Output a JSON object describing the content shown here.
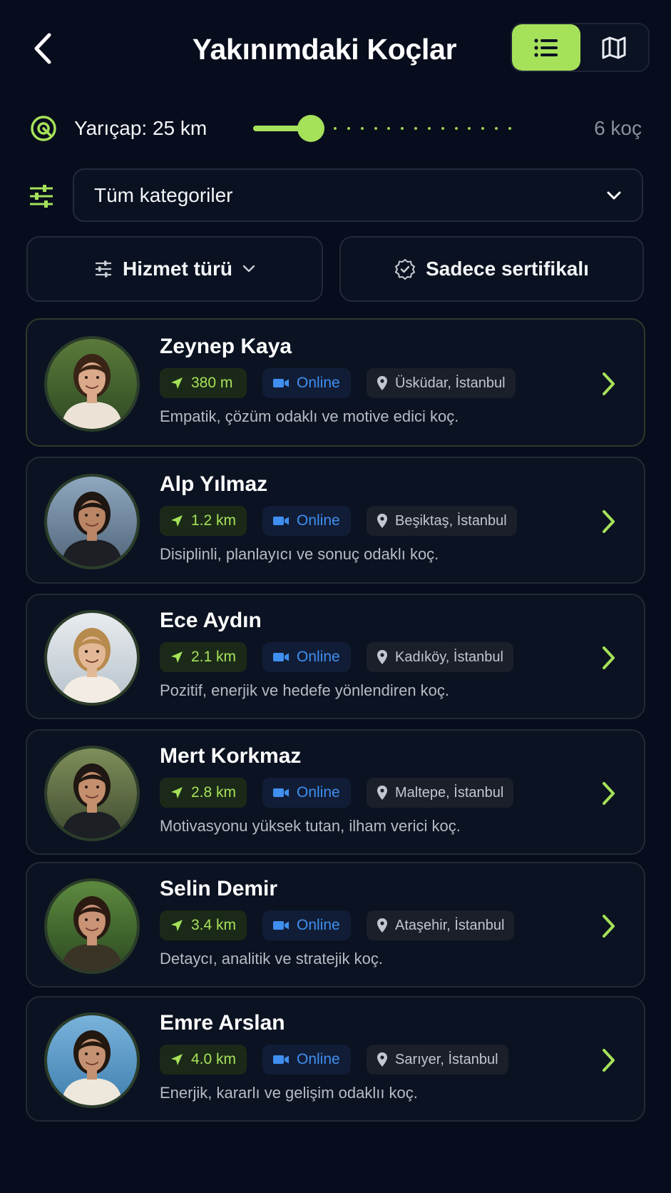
{
  "header": {
    "title": "Yakınımdaki Koçlar"
  },
  "filters": {
    "radius_label": "Yarıçap: 25 km",
    "radius_fraction": 0.22,
    "coach_count": "6 koç",
    "category": "Tüm kategoriler",
    "service_type": "Hizmet türü",
    "certified_only": "Sadece sertifikalı"
  },
  "colors": {
    "accent": "#a6e15a",
    "online": "#3f8ff0",
    "background": "#070d1c"
  },
  "coaches": [
    {
      "name": "Zeynep Kaya",
      "distance": "380 m",
      "mode": "Online",
      "location": "Üsküdar, İstanbul",
      "description": "Empatik, çözüm odaklı ve motive edici koç."
    },
    {
      "name": "Alp Yılmaz",
      "distance": "1.2 km",
      "mode": "Online",
      "location": "Beşiktaş, İstanbul",
      "description": "Disiplinli, planlayıcı ve sonuç odaklı koç."
    },
    {
      "name": "Ece Aydın",
      "distance": "2.1 km",
      "mode": "Online",
      "location": "Kadıköy, İstanbul",
      "description": "Pozitif, enerjik ve hedefe yönlendiren koç."
    },
    {
      "name": "Mert Korkmaz",
      "distance": "2.8 km",
      "mode": "Online",
      "location": "Maltepe, İstanbul",
      "description": "Motivasyonu yüksek tutan, ilham verici koç."
    },
    {
      "name": "Selin Demir",
      "distance": "3.4 km",
      "mode": "Online",
      "location": "Ataşehir, İstanbul",
      "description": "Detaycı, analitik ve stratejik koç."
    },
    {
      "name": "Emre Arslan",
      "distance": "4.0 km",
      "mode": "Online",
      "location": "Sarıyer, İstanbul",
      "description": "Enerjik, kararlı ve gelişim odaklıı koç."
    }
  ]
}
